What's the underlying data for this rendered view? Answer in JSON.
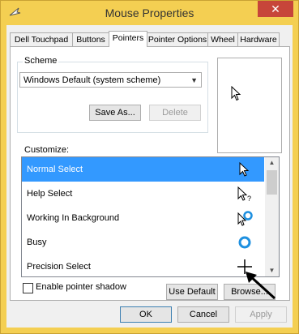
{
  "window": {
    "title": "Mouse Properties",
    "close_glyph": "✕",
    "icon": "mouse-cursor-icon",
    "frame_color": "#f4cf52"
  },
  "tabs": [
    {
      "label": "Dell Touchpad"
    },
    {
      "label": "Buttons"
    },
    {
      "label": "Pointers",
      "active": true
    },
    {
      "label": "Pointer Options"
    },
    {
      "label": "Wheel"
    },
    {
      "label": "Hardware"
    }
  ],
  "scheme": {
    "legend": "Scheme",
    "selected": "Windows Default (system scheme)",
    "save_as": "Save As...",
    "delete": "Delete"
  },
  "customize": {
    "label": "Customize:",
    "selection_color": "#3399ff",
    "items": [
      {
        "label": "Normal Select",
        "icon": "arrow-cursor-icon",
        "selected": true
      },
      {
        "label": "Help Select",
        "icon": "help-cursor-icon"
      },
      {
        "label": "Working In Background",
        "icon": "working-cursor-icon"
      },
      {
        "label": "Busy",
        "icon": "busy-cursor-icon"
      },
      {
        "label": "Precision Select",
        "icon": "crosshair-cursor-icon"
      }
    ]
  },
  "options": {
    "shadow_label": "Enable pointer shadow",
    "shadow_checked": false,
    "use_default": "Use Default",
    "browse": "Browse..."
  },
  "footer": {
    "ok": "OK",
    "cancel": "Cancel",
    "apply": "Apply"
  }
}
